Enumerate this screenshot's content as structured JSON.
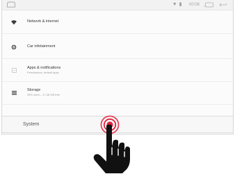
{
  "status_bar": {
    "glyphs": "▼ ▮",
    "time": "00:06",
    "icons": [
      "home-icon",
      "wifi-signal-icon",
      "battery-icon",
      "recents-icon",
      "back-icon"
    ]
  },
  "settings": {
    "items": [
      {
        "label": "Network & internet",
        "subtitle": "",
        "icon": "wifi-icon"
      },
      {
        "label": "Car infotainment",
        "subtitle": "",
        "icon": "settings-gear-icon"
      },
      {
        "label": "Apps & notifications",
        "subtitle": "Permissions, default apps",
        "icon": "apps-icon"
      },
      {
        "label": "Storage",
        "subtitle": "45% used – 17.48 GB free",
        "icon": "storage-icon"
      }
    ],
    "system_label": "System"
  },
  "colors": {
    "tap_ring": "#e0213b",
    "hand": "#111111",
    "text_primary": "#333333",
    "text_secondary": "#9a9a9a"
  }
}
